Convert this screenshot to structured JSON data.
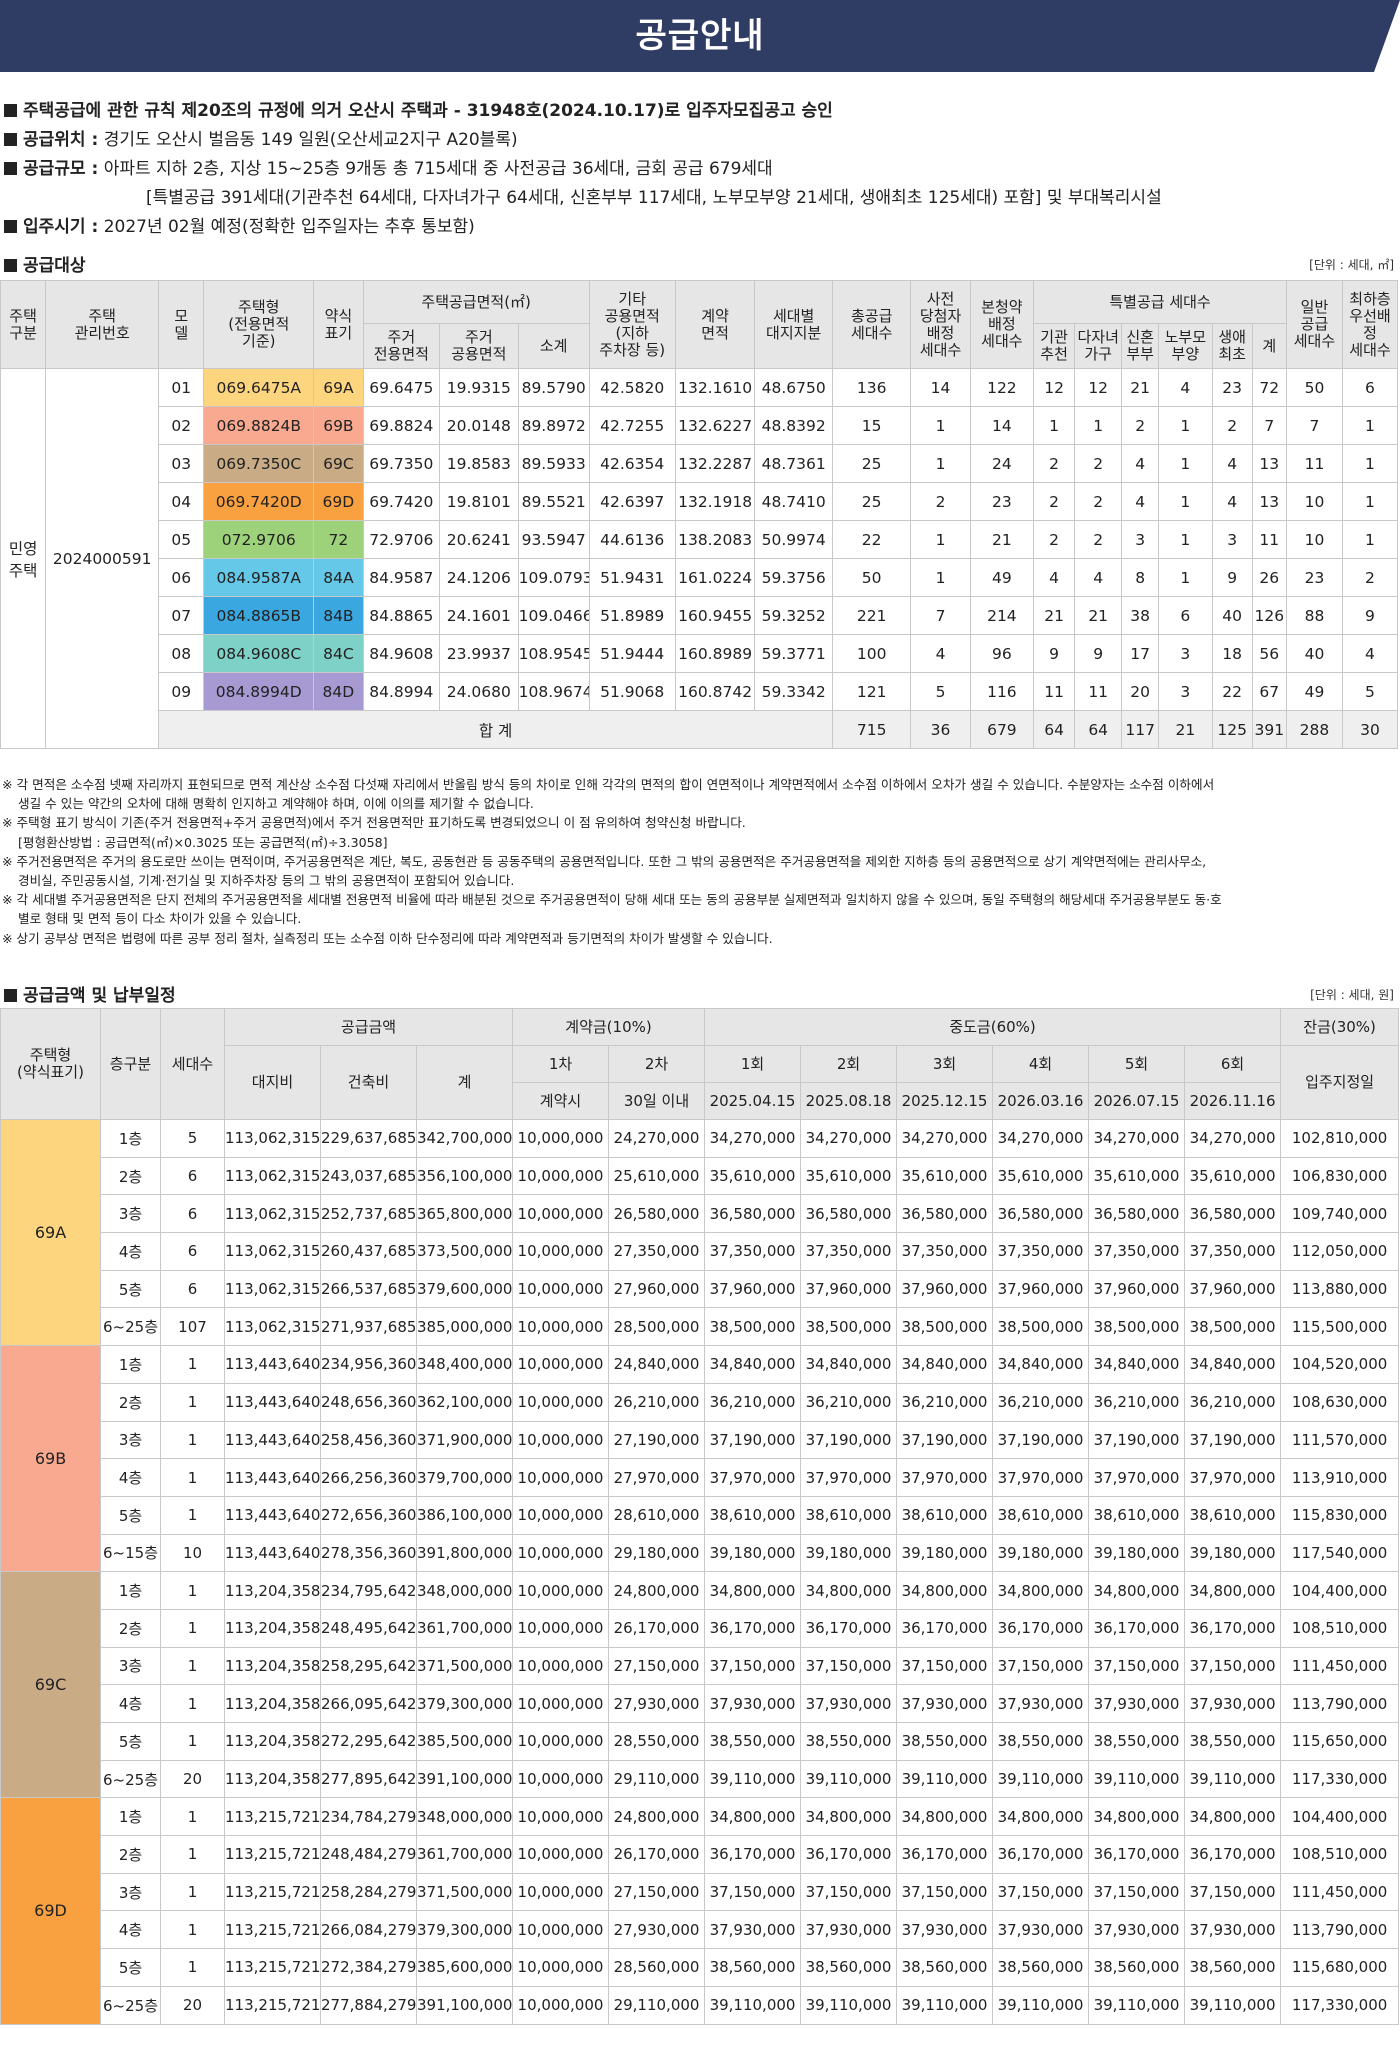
{
  "banner": {
    "title": "공급안내"
  },
  "info": {
    "line1": "주택공급에 관한 규칙 제20조의 규정에 의거 오산시 주택과 - 31948호(2024.10.17)로 입주자모집공고 승인",
    "loc_label": "공급위치 :",
    "loc_value": "경기도 오산시 벌음동 149 일원(오산세교2지구 A20블록)",
    "scale_label": "공급규모 :",
    "scale_value": "아파트 지하 2층, 지상 15~25층 9개동 총 715세대 중 사전공급 36세대, 금회 공급 679세대",
    "scale_value2": "[특별공급 391세대(기관추천 64세대, 다자녀가구 64세대, 신혼부부 117세대, 노부모부양 21세대, 생애최초 125세대) 포함] 및 부대복리시설",
    "move_label": "입주시기 :",
    "move_value": "2027년 02월 예정(정확한 입주일자는 추후 통보함)"
  },
  "section1": {
    "title": "공급대상",
    "unit": "[단위 : 세대, ㎡]",
    "headers": {
      "house_class": "주택\n구분",
      "mgmt_no": "주택\n관리번호",
      "model": "모\n델",
      "type": "주택형\n(전용면적\n기준)",
      "abbr": "약식\n표기",
      "area_group": "주택공급면적(㎡)",
      "exclusive": "주거\n전용면적",
      "common": "주거\n공용면적",
      "subtotal": "소계",
      "other_common": "기타\n공용면적\n(지하\n주차장 등)",
      "contract_area": "계약\n면적",
      "land_share": "세대별\n대지지분",
      "total_units": "총공급\n세대수",
      "pre_units": "사전\n당첨자\n배정\n세대수",
      "main_units": "본청약\n배정\n세대수",
      "special_group": "특별공급 세대수",
      "institution": "기관\n추천",
      "multichild": "다자녀\n가구",
      "newlywed": "신혼\n부부",
      "parents": "노부모\n부양",
      "firsttime": "생애\n최초",
      "sum": "계",
      "general": "일반\n공급\n세대수",
      "lowest_floor": "최하층\n우선배정\n세대수"
    },
    "house_class": "민영\n주택",
    "mgmt_no": "2024000591",
    "rows": [
      {
        "model": "01",
        "type": "069.6475A",
        "abbr": "69A",
        "color": "#fdd57f",
        "ex": "69.6475",
        "co": "19.9315",
        "sub": "89.5790",
        "oc": "42.5820",
        "ca": "132.1610",
        "ls": "48.6750",
        "total": "136",
        "pre": "14",
        "main": "122",
        "s1": "12",
        "s2": "12",
        "s3": "21",
        "s4": "4",
        "s5": "23",
        "ssum": "72",
        "gen": "50",
        "low": "6"
      },
      {
        "model": "02",
        "type": "069.8824B",
        "abbr": "69B",
        "color": "#f9a990",
        "ex": "69.8824",
        "co": "20.0148",
        "sub": "89.8972",
        "oc": "42.7255",
        "ca": "132.6227",
        "ls": "48.8392",
        "total": "15",
        "pre": "1",
        "main": "14",
        "s1": "1",
        "s2": "1",
        "s3": "2",
        "s4": "1",
        "s5": "2",
        "ssum": "7",
        "gen": "7",
        "low": "1"
      },
      {
        "model": "03",
        "type": "069.7350C",
        "abbr": "69C",
        "color": "#c9ab86",
        "ex": "69.7350",
        "co": "19.8583",
        "sub": "89.5933",
        "oc": "42.6354",
        "ca": "132.2287",
        "ls": "48.7361",
        "total": "25",
        "pre": "1",
        "main": "24",
        "s1": "2",
        "s2": "2",
        "s3": "4",
        "s4": "1",
        "s5": "4",
        "ssum": "13",
        "gen": "11",
        "low": "1"
      },
      {
        "model": "04",
        "type": "069.7420D",
        "abbr": "69D",
        "color": "#f9a140",
        "ex": "69.7420",
        "co": "19.8101",
        "sub": "89.5521",
        "oc": "42.6397",
        "ca": "132.1918",
        "ls": "48.7410",
        "total": "25",
        "pre": "2",
        "main": "23",
        "s1": "2",
        "s2": "2",
        "s3": "4",
        "s4": "1",
        "s5": "4",
        "ssum": "13",
        "gen": "10",
        "low": "1"
      },
      {
        "model": "05",
        "type": "072.9706",
        "abbr": "72",
        "color": "#9ed27a",
        "ex": "72.9706",
        "co": "20.6241",
        "sub": "93.5947",
        "oc": "44.6136",
        "ca": "138.2083",
        "ls": "50.9974",
        "total": "22",
        "pre": "1",
        "main": "21",
        "s1": "2",
        "s2": "2",
        "s3": "3",
        "s4": "1",
        "s5": "3",
        "ssum": "11",
        "gen": "10",
        "low": "1"
      },
      {
        "model": "06",
        "type": "084.9587A",
        "abbr": "84A",
        "color": "#66c8e8",
        "ex": "84.9587",
        "co": "24.1206",
        "sub": "109.0793",
        "oc": "51.9431",
        "ca": "161.0224",
        "ls": "59.3756",
        "total": "50",
        "pre": "1",
        "main": "49",
        "s1": "4",
        "s2": "4",
        "s3": "8",
        "s4": "1",
        "s5": "9",
        "ssum": "26",
        "gen": "23",
        "low": "2"
      },
      {
        "model": "07",
        "type": "084.8865B",
        "abbr": "84B",
        "color": "#3aa7e0",
        "ex": "84.8865",
        "co": "24.1601",
        "sub": "109.0466",
        "oc": "51.8989",
        "ca": "160.9455",
        "ls": "59.3252",
        "total": "221",
        "pre": "7",
        "main": "214",
        "s1": "21",
        "s2": "21",
        "s3": "38",
        "s4": "6",
        "s5": "40",
        "ssum": "126",
        "gen": "88",
        "low": "9"
      },
      {
        "model": "08",
        "type": "084.9608C",
        "abbr": "84C",
        "color": "#7ed1c6",
        "ex": "84.9608",
        "co": "23.9937",
        "sub": "108.9545",
        "oc": "51.9444",
        "ca": "160.8989",
        "ls": "59.3771",
        "total": "100",
        "pre": "4",
        "main": "96",
        "s1": "9",
        "s2": "9",
        "s3": "17",
        "s4": "3",
        "s5": "18",
        "ssum": "56",
        "gen": "40",
        "low": "4"
      },
      {
        "model": "09",
        "type": "084.8994D",
        "abbr": "84D",
        "color": "#a79ad3",
        "ex": "84.8994",
        "co": "24.0680",
        "sub": "108.9674",
        "oc": "51.9068",
        "ca": "160.8742",
        "ls": "59.3342",
        "total": "121",
        "pre": "5",
        "main": "116",
        "s1": "11",
        "s2": "11",
        "s3": "20",
        "s4": "3",
        "s5": "22",
        "ssum": "67",
        "gen": "49",
        "low": "5"
      }
    ],
    "sum": {
      "label": "합 계",
      "total": "715",
      "pre": "36",
      "main": "679",
      "s1": "64",
      "s2": "64",
      "s3": "117",
      "s4": "21",
      "s5": "125",
      "ssum": "391",
      "gen": "288",
      "low": "30"
    }
  },
  "notes": [
    {
      "type": "n",
      "text": "※ 각 면적은 소수점 넷째 자리까지 표현되므로 면적 계산상 소수점 다섯째 자리에서 반올림 방식 등의 차이로 인해 각각의 면적의 합이 연면적이나 계약면적에서 소수점 이하에서 오차가 생길 수 있습니다. 수분양자는 소수점 이하에서"
    },
    {
      "type": "c",
      "text": "생길 수 있는 약간의 오차에 대해 명확히 인지하고 계약해야 하며, 이에 이의를 제기할 수 없습니다."
    },
    {
      "type": "n",
      "text": "※ 주택형 표기 방식이 기존(주거 전용면적+주거 공용면적)에서 주거 전용면적만 표기하도록 변경되었으니 이 점 유의하여 청약신청 바랍니다."
    },
    {
      "type": "c",
      "text": "[평형환산방법 : 공급면적(㎡)×0.3025 또는 공급면적(㎡)÷3.3058]"
    },
    {
      "type": "n",
      "text": "※ 주거전용면적은 주거의 용도로만 쓰이는 면적이며, 주거공용면적은 계단, 복도, 공동현관 등 공동주택의 공용면적입니다. 또한 그 밖의 공용면적은 주거공용면적을 제외한 지하층 등의 공용면적으로 상기 계약면적에는 관리사무소,"
    },
    {
      "type": "c",
      "text": "경비실, 주민공동시설, 기계·전기실 및 지하주차장 등의 그 밖의 공용면적이 포함되어 있습니다."
    },
    {
      "type": "n",
      "text": "※ 각 세대별 주거공용면적은 단지 전체의 주거공용면적을 세대별 전용면적 비율에 따라 배분된 것으로 주거공용면적이 당해 세대 또는 동의 공용부분 실제면적과 일치하지 않을 수 있으며, 동일 주택형의 해당세대 주거공용부분도 동·호"
    },
    {
      "type": "c",
      "text": "별로 형태 및 면적 등이 다소 차이가 있을 수 있습니다."
    },
    {
      "type": "n",
      "text": "※ 상기 공부상 면적은 법령에 따른 공부 정리 절차, 실측정리 또는 소수점 이하 단수정리에 따라 계약면적과 등기면적의 차이가 발생할 수 있습니다."
    }
  ],
  "section2": {
    "title": "공급금액 및 납부일정",
    "unit": "[단위 : 세대, 원]",
    "headers": {
      "type": "주택형\n(약식표기)",
      "floor": "층구분",
      "units": "세대수",
      "supply_group": "공급금액",
      "land": "대지비",
      "building": "건축비",
      "total": "계",
      "deposit_group": "계약금(10%)",
      "d1": "1차",
      "d2": "2차",
      "d1_when": "계약시",
      "d2_when": "30일 이내",
      "middle_group": "중도금(60%)",
      "m1": "1회",
      "m2": "2회",
      "m3": "3회",
      "m4": "4회",
      "m5": "5회",
      "m6": "6회",
      "m1_date": "2025.04.15",
      "m2_date": "2025.08.18",
      "m3_date": "2025.12.15",
      "m4_date": "2026.03.16",
      "m5_date": "2026.07.15",
      "m6_date": "2026.11.16",
      "balance_group": "잔금(30%)",
      "balance_when": "입주지정일"
    },
    "groups": [
      {
        "type": "69A",
        "color": "#fdd57f",
        "rows": [
          {
            "floor": "1층",
            "units": "5",
            "land": "113,062,315",
            "build": "229,637,685",
            "total": "342,700,000",
            "d1": "10,000,000",
            "d2": "24,270,000",
            "mid": "34,270,000",
            "bal": "102,810,000"
          },
          {
            "floor": "2층",
            "units": "6",
            "land": "113,062,315",
            "build": "243,037,685",
            "total": "356,100,000",
            "d1": "10,000,000",
            "d2": "25,610,000",
            "mid": "35,610,000",
            "bal": "106,830,000"
          },
          {
            "floor": "3층",
            "units": "6",
            "land": "113,062,315",
            "build": "252,737,685",
            "total": "365,800,000",
            "d1": "10,000,000",
            "d2": "26,580,000",
            "mid": "36,580,000",
            "bal": "109,740,000"
          },
          {
            "floor": "4층",
            "units": "6",
            "land": "113,062,315",
            "build": "260,437,685",
            "total": "373,500,000",
            "d1": "10,000,000",
            "d2": "27,350,000",
            "mid": "37,350,000",
            "bal": "112,050,000"
          },
          {
            "floor": "5층",
            "units": "6",
            "land": "113,062,315",
            "build": "266,537,685",
            "total": "379,600,000",
            "d1": "10,000,000",
            "d2": "27,960,000",
            "mid": "37,960,000",
            "bal": "113,880,000"
          },
          {
            "floor": "6~25층",
            "units": "107",
            "land": "113,062,315",
            "build": "271,937,685",
            "total": "385,000,000",
            "d1": "10,000,000",
            "d2": "28,500,000",
            "mid": "38,500,000",
            "bal": "115,500,000"
          }
        ]
      },
      {
        "type": "69B",
        "color": "#f9a990",
        "rows": [
          {
            "floor": "1층",
            "units": "1",
            "land": "113,443,640",
            "build": "234,956,360",
            "total": "348,400,000",
            "d1": "10,000,000",
            "d2": "24,840,000",
            "mid": "34,840,000",
            "bal": "104,520,000"
          },
          {
            "floor": "2층",
            "units": "1",
            "land": "113,443,640",
            "build": "248,656,360",
            "total": "362,100,000",
            "d1": "10,000,000",
            "d2": "26,210,000",
            "mid": "36,210,000",
            "bal": "108,630,000"
          },
          {
            "floor": "3층",
            "units": "1",
            "land": "113,443,640",
            "build": "258,456,360",
            "total": "371,900,000",
            "d1": "10,000,000",
            "d2": "27,190,000",
            "mid": "37,190,000",
            "bal": "111,570,000"
          },
          {
            "floor": "4층",
            "units": "1",
            "land": "113,443,640",
            "build": "266,256,360",
            "total": "379,700,000",
            "d1": "10,000,000",
            "d2": "27,970,000",
            "mid": "37,970,000",
            "bal": "113,910,000"
          },
          {
            "floor": "5층",
            "units": "1",
            "land": "113,443,640",
            "build": "272,656,360",
            "total": "386,100,000",
            "d1": "10,000,000",
            "d2": "28,610,000",
            "mid": "38,610,000",
            "bal": "115,830,000"
          },
          {
            "floor": "6~15층",
            "units": "10",
            "land": "113,443,640",
            "build": "278,356,360",
            "total": "391,800,000",
            "d1": "10,000,000",
            "d2": "29,180,000",
            "mid": "39,180,000",
            "bal": "117,540,000"
          }
        ]
      },
      {
        "type": "69C",
        "color": "#c9ab86",
        "rows": [
          {
            "floor": "1층",
            "units": "1",
            "land": "113,204,358",
            "build": "234,795,642",
            "total": "348,000,000",
            "d1": "10,000,000",
            "d2": "24,800,000",
            "mid": "34,800,000",
            "bal": "104,400,000"
          },
          {
            "floor": "2층",
            "units": "1",
            "land": "113,204,358",
            "build": "248,495,642",
            "total": "361,700,000",
            "d1": "10,000,000",
            "d2": "26,170,000",
            "mid": "36,170,000",
            "bal": "108,510,000"
          },
          {
            "floor": "3층",
            "units": "1",
            "land": "113,204,358",
            "build": "258,295,642",
            "total": "371,500,000",
            "d1": "10,000,000",
            "d2": "27,150,000",
            "mid": "37,150,000",
            "bal": "111,450,000"
          },
          {
            "floor": "4층",
            "units": "1",
            "land": "113,204,358",
            "build": "266,095,642",
            "total": "379,300,000",
            "d1": "10,000,000",
            "d2": "27,930,000",
            "mid": "37,930,000",
            "bal": "113,790,000"
          },
          {
            "floor": "5층",
            "units": "1",
            "land": "113,204,358",
            "build": "272,295,642",
            "total": "385,500,000",
            "d1": "10,000,000",
            "d2": "28,550,000",
            "mid": "38,550,000",
            "bal": "115,650,000"
          },
          {
            "floor": "6~25층",
            "units": "20",
            "land": "113,204,358",
            "build": "277,895,642",
            "total": "391,100,000",
            "d1": "10,000,000",
            "d2": "29,110,000",
            "mid": "39,110,000",
            "bal": "117,330,000"
          }
        ]
      },
      {
        "type": "69D",
        "color": "#f9a140",
        "rows": [
          {
            "floor": "1층",
            "units": "1",
            "land": "113,215,721",
            "build": "234,784,279",
            "total": "348,000,000",
            "d1": "10,000,000",
            "d2": "24,800,000",
            "mid": "34,800,000",
            "bal": "104,400,000"
          },
          {
            "floor": "2층",
            "units": "1",
            "land": "113,215,721",
            "build": "248,484,279",
            "total": "361,700,000",
            "d1": "10,000,000",
            "d2": "26,170,000",
            "mid": "36,170,000",
            "bal": "108,510,000"
          },
          {
            "floor": "3층",
            "units": "1",
            "land": "113,215,721",
            "build": "258,284,279",
            "total": "371,500,000",
            "d1": "10,000,000",
            "d2": "27,150,000",
            "mid": "37,150,000",
            "bal": "111,450,000"
          },
          {
            "floor": "4층",
            "units": "1",
            "land": "113,215,721",
            "build": "266,084,279",
            "total": "379,300,000",
            "d1": "10,000,000",
            "d2": "27,930,000",
            "mid": "37,930,000",
            "bal": "113,790,000"
          },
          {
            "floor": "5층",
            "units": "1",
            "land": "113,215,721",
            "build": "272,384,279",
            "total": "385,600,000",
            "d1": "10,000,000",
            "d2": "28,560,000",
            "mid": "38,560,000",
            "bal": "115,680,000"
          },
          {
            "floor": "6~25층",
            "units": "20",
            "land": "113,215,721",
            "build": "277,884,279",
            "total": "391,100,000",
            "d1": "10,000,000",
            "d2": "29,110,000",
            "mid": "39,110,000",
            "bal": "117,330,000"
          }
        ]
      }
    ]
  }
}
